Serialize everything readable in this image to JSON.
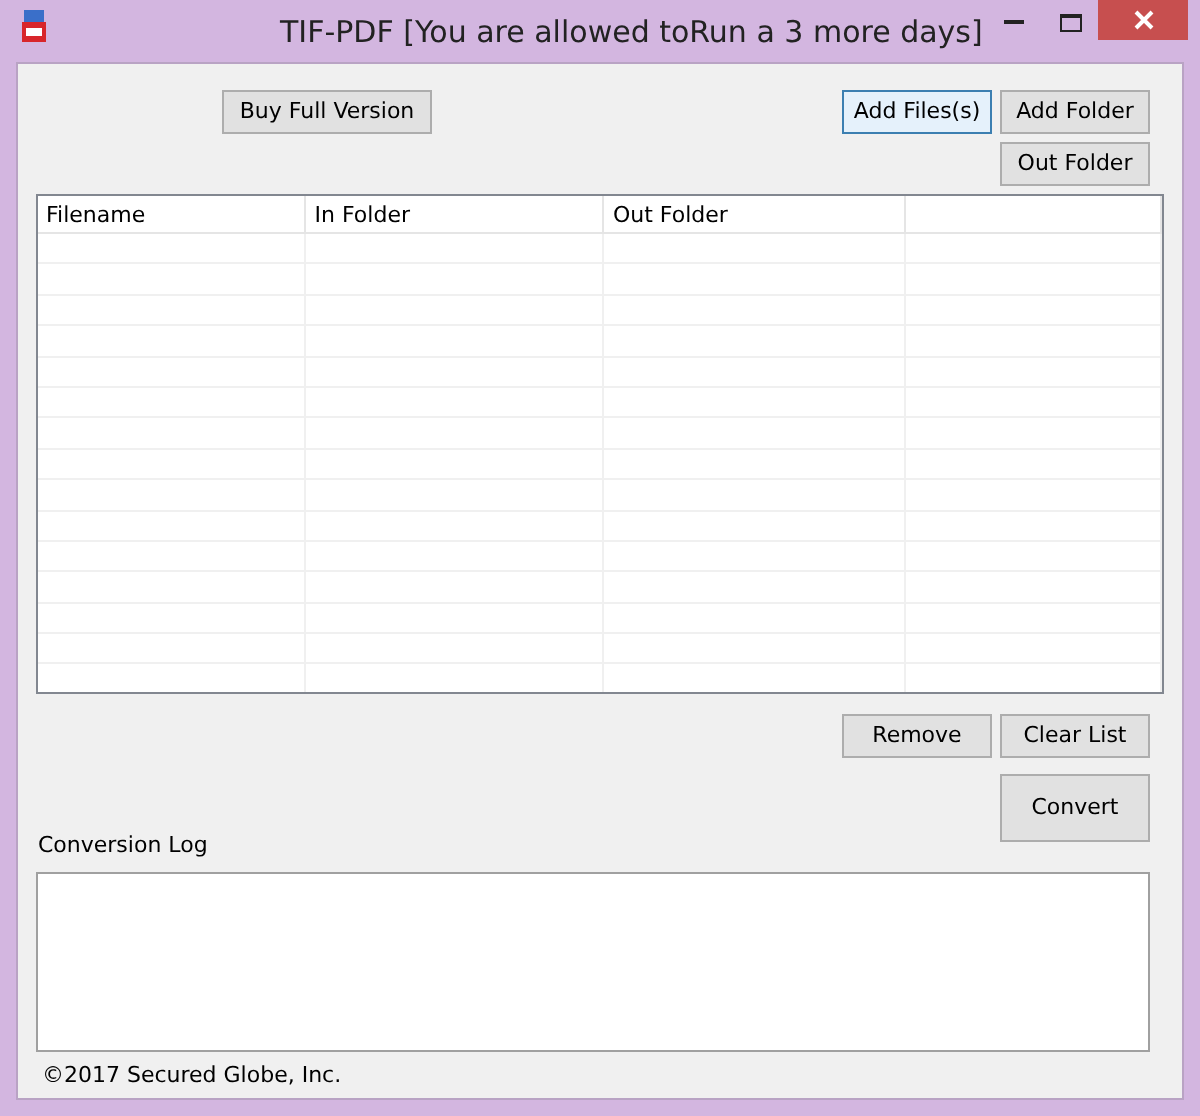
{
  "window": {
    "title": "TIF-PDF [You are allowed toRun a 3 more days]"
  },
  "top_buttons": [
    {
      "label": "Buy Full Version",
      "focused": false
    },
    {
      "label": "Add Files(s)",
      "focused": true
    },
    {
      "label": "Add Folder",
      "focused": false
    },
    {
      "label": "Out Folder",
      "focused": false
    }
  ],
  "table": {
    "columns": [
      "Filename",
      "In Folder",
      "Out Folder"
    ]
  },
  "list_buttons": [
    {
      "label": "Remove",
      "focused": false
    },
    {
      "label": "Clear List",
      "focused": false
    }
  ],
  "convert_button": {
    "label": "Convert",
    "focused": false
  },
  "log": {
    "label": "Conversion Log"
  },
  "footer": "©2017 Secured Globe, Inc."
}
